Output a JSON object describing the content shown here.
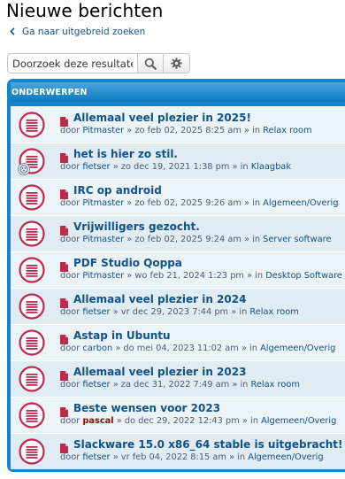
{
  "page": {
    "title": "Nieuwe berichten",
    "back_link": "Ga naar uitgebreid zoeken"
  },
  "search": {
    "placeholder": "Doorzoek deze resultaten",
    "search_icon": "search-icon",
    "advanced_icon": "gear-icon"
  },
  "topics": {
    "header": "ONDERWERPEN",
    "by_prefix": "door",
    "in_prefix": "» in",
    "items": [
      {
        "title": "Allemaal veel plezier in 2025!",
        "author": "Pitmaster",
        "date": "» zo feb 02, 2025 8:25 am",
        "forum": "Relax room"
      },
      {
        "title": "het is hier zo stil.",
        "author": "fietser",
        "date": "» zo dec 19, 2021 1:38 pm",
        "forum": "Klaagbak"
      },
      {
        "title": "IRC op android",
        "author": "Pitmaster",
        "date": "» zo feb 02, 2025 9:26 am",
        "forum": "Algemeen/Overig"
      },
      {
        "title": "Vrijwilligers gezocht.",
        "author": "Pitmaster",
        "date": "» zo feb 02, 2025 9:24 am",
        "forum": "Server software"
      },
      {
        "title": "PDF Studio Qoppa",
        "author": "Pitmaster",
        "date": "» wo feb 21, 2024 1:23 pm",
        "forum": "Desktop Software"
      },
      {
        "title": "Allemaal veel plezier in 2024",
        "author": "fietser",
        "date": "» vr dec 29, 2023 7:44 pm",
        "forum": "Relax room"
      },
      {
        "title": "Astap in Ubuntu",
        "author": "carbon",
        "date": "» do mei 04, 2023 11:02 am",
        "forum": "Algemeen/Overig"
      },
      {
        "title": "Allemaal veel plezier in 2023",
        "author": "fietser",
        "date": "» za dec 31, 2022 7:49 am",
        "forum": "Relax room"
      },
      {
        "title": "Beste wensen voor 2023",
        "author": "pascal",
        "date": "» do dec 29, 2022 12:43 pm",
        "forum": "Algemeen/Overig"
      },
      {
        "title": "Slackware 15.0 x86_64 stable is uitgebracht!",
        "author": "fietser",
        "date": "» vr feb 04, 2022 8:15 am",
        "forum": "Algemeen/Overig"
      }
    ]
  },
  "colors": {
    "accent": "#1186cc",
    "link": "#105289",
    "unread_icon": "#bc2a4d",
    "admin_name": "#aa0000"
  }
}
